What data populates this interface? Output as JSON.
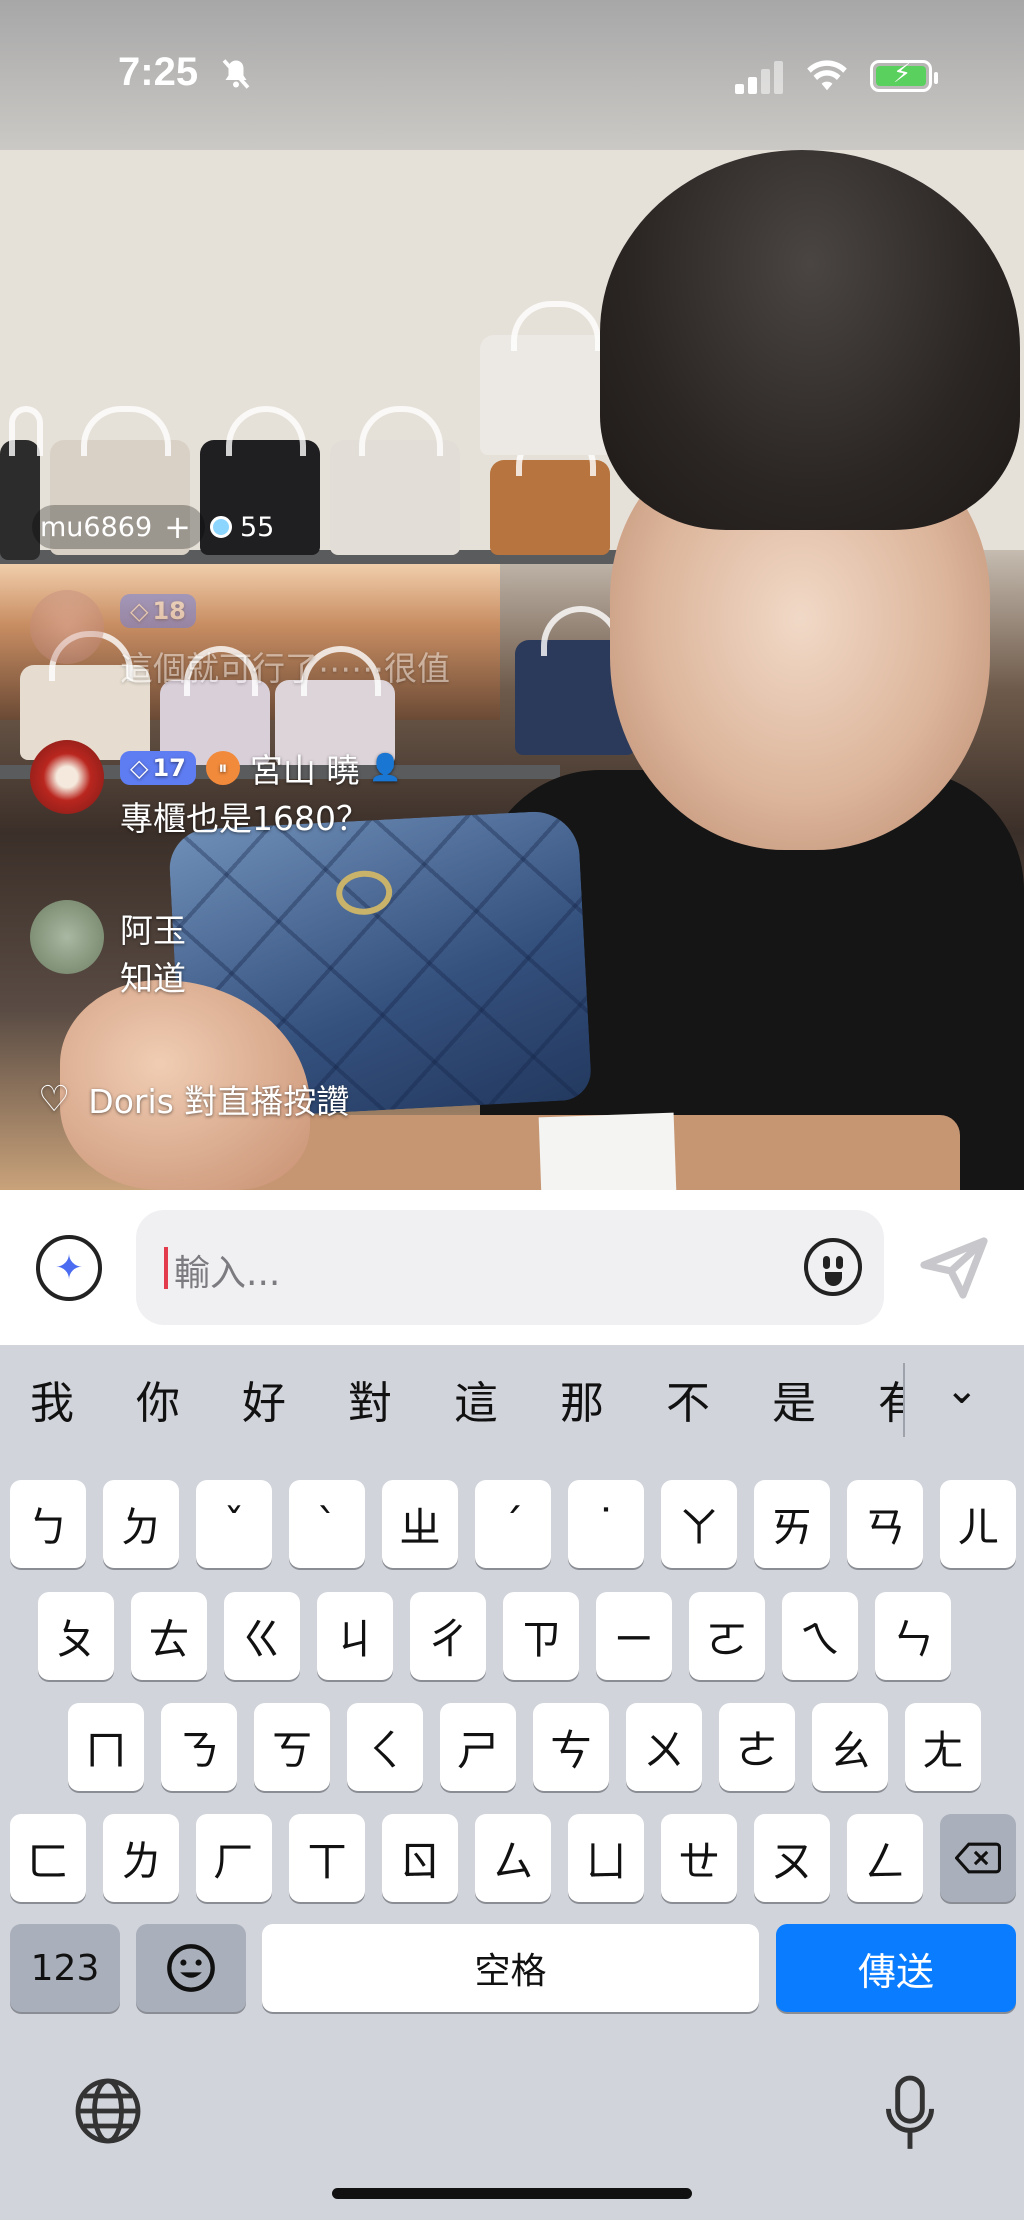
{
  "status_bar": {
    "time": "7:25",
    "silent_icon": "bell-slash-icon",
    "signal_icon": "cellular-signal-icon",
    "wifi_icon": "wifi-icon",
    "battery_icon": "battery-charging-icon"
  },
  "live": {
    "host_username": "mu6869",
    "follow_icon": "plus-icon",
    "viewer_count": "55",
    "comments": [
      {
        "level": "18",
        "name": "",
        "text": "這個就可行了⋯⋯很值",
        "faded": true
      },
      {
        "level": "17",
        "name": "宮山 曉",
        "text": "專櫃也是1680？",
        "faded": false
      },
      {
        "level": "",
        "name": "阿玉",
        "text": "知道",
        "faded": false
      }
    ],
    "like_event": "Doris 對直播按讚"
  },
  "input_bar": {
    "placeholder": "輸入...",
    "ai_icon": "sparkle-icon",
    "emoji_icon": "emoji-icon",
    "send_icon": "send-icon"
  },
  "keyboard": {
    "candidates": [
      "我",
      "你",
      "好",
      "對",
      "這",
      "那",
      "不",
      "是",
      "有"
    ],
    "rows": [
      [
        "ㄅ",
        "ㄉ",
        "ˇ",
        "ˋ",
        "ㄓ",
        "ˊ",
        "˙",
        "ㄚ",
        "ㄞ",
        "ㄢ",
        "ㄦ"
      ],
      [
        "ㄆ",
        "ㄊ",
        "ㄍ",
        "ㄐ",
        "ㄔ",
        "ㄗ",
        "ㄧ",
        "ㄛ",
        "ㄟ",
        "ㄣ"
      ],
      [
        "ㄇ",
        "ㄋ",
        "ㄎ",
        "ㄑ",
        "ㄕ",
        "ㄘ",
        "ㄨ",
        "ㄜ",
        "ㄠ",
        "ㄤ"
      ],
      [
        "ㄈ",
        "ㄌ",
        "ㄏ",
        "ㄒ",
        "ㄖ",
        "ㄙ",
        "ㄩ",
        "ㄝ",
        "ㄡ",
        "ㄥ"
      ]
    ],
    "numbers_key": "123",
    "space_key": "空格",
    "send_key": "傳送",
    "delete_icon": "backspace-icon",
    "emoji_key_icon": "emoji-icon",
    "globe_icon": "globe-icon",
    "mic_icon": "microphone-icon"
  }
}
